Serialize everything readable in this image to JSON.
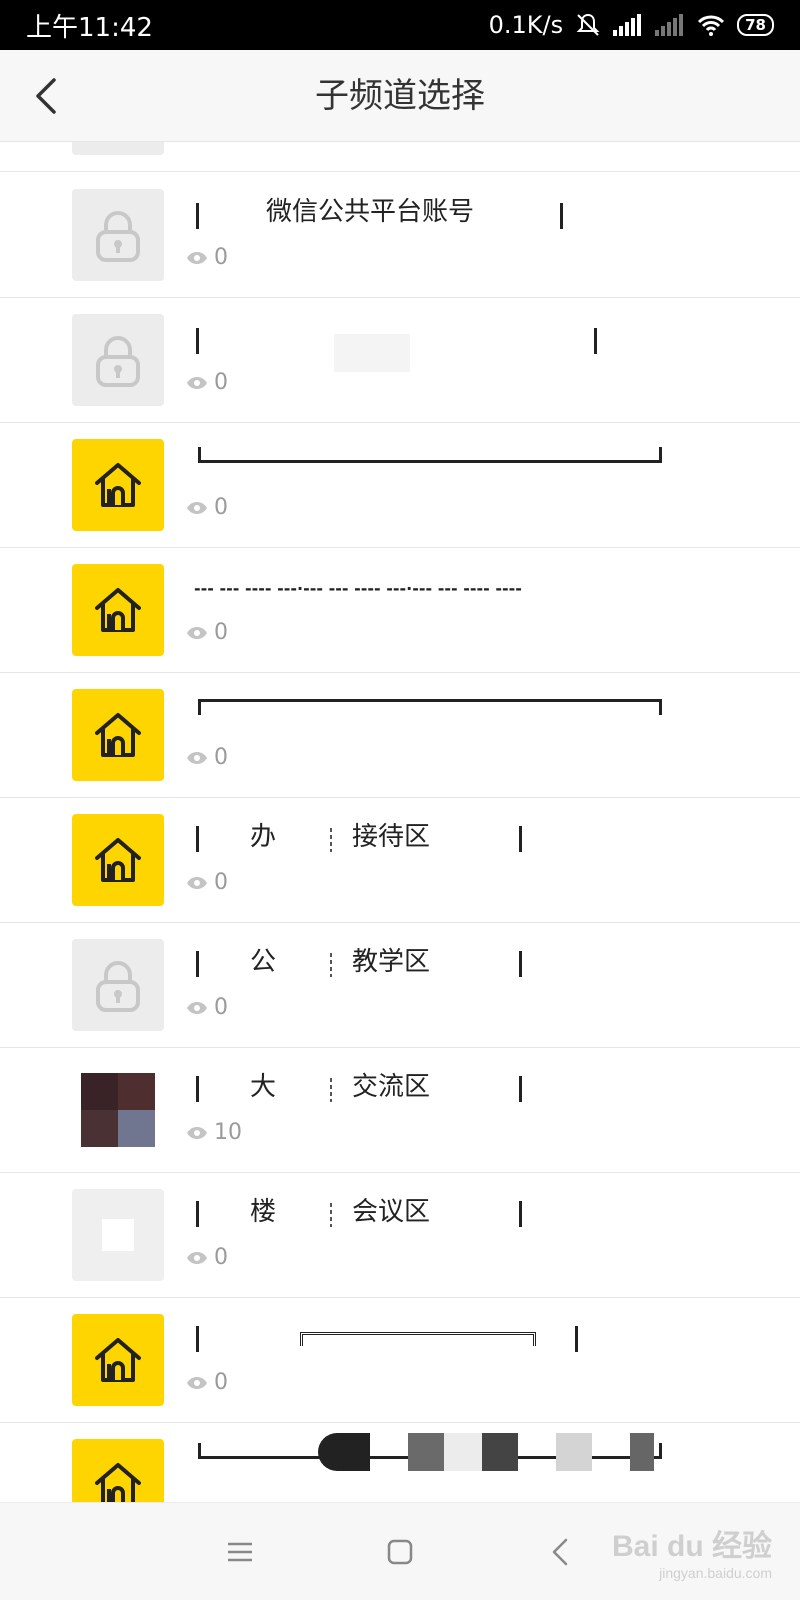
{
  "status_bar": {
    "time": "上午11:42",
    "speed": "0.1K/s",
    "battery": "78"
  },
  "header": {
    "title": "子频道选择"
  },
  "list": [
    {
      "icon": "lock",
      "title": "",
      "views": "0"
    },
    {
      "icon": "lock",
      "title": "微信公共平台账号",
      "views": "0"
    },
    {
      "icon": "lock",
      "title": "",
      "views": "0"
    },
    {
      "icon": "home",
      "title": "",
      "views": "0"
    },
    {
      "icon": "home",
      "title": "--- --- ---- ---·--- --- ---- ---·--- --- ---- ----",
      "views": "0"
    },
    {
      "icon": "home",
      "title": "",
      "views": "0"
    },
    {
      "icon": "home",
      "title_left": "办",
      "title_right": "接待区",
      "views": "0"
    },
    {
      "icon": "lock",
      "title_left": "公",
      "title_right": "教学区",
      "views": "0"
    },
    {
      "icon": "photo",
      "title_left": "大",
      "title_right": "交流区",
      "views": "10"
    },
    {
      "icon": "photo-blank",
      "title_left": "楼",
      "title_right": "会议区",
      "views": "0"
    },
    {
      "icon": "home",
      "title": "",
      "views": "0"
    },
    {
      "icon": "home",
      "title": "",
      "views": ""
    }
  ],
  "nav_bar": {
    "menu_icon": "menu-icon",
    "home_icon": "home-square-icon",
    "back_icon": "back-chevron-icon"
  },
  "watermark": {
    "main": "Bai du 经验",
    "sub": "jingyan.baidu.com"
  },
  "colors": {
    "accent_yellow": "#ffd500",
    "lock_bg": "#ececec",
    "text_grey": "#9a9a9a"
  }
}
